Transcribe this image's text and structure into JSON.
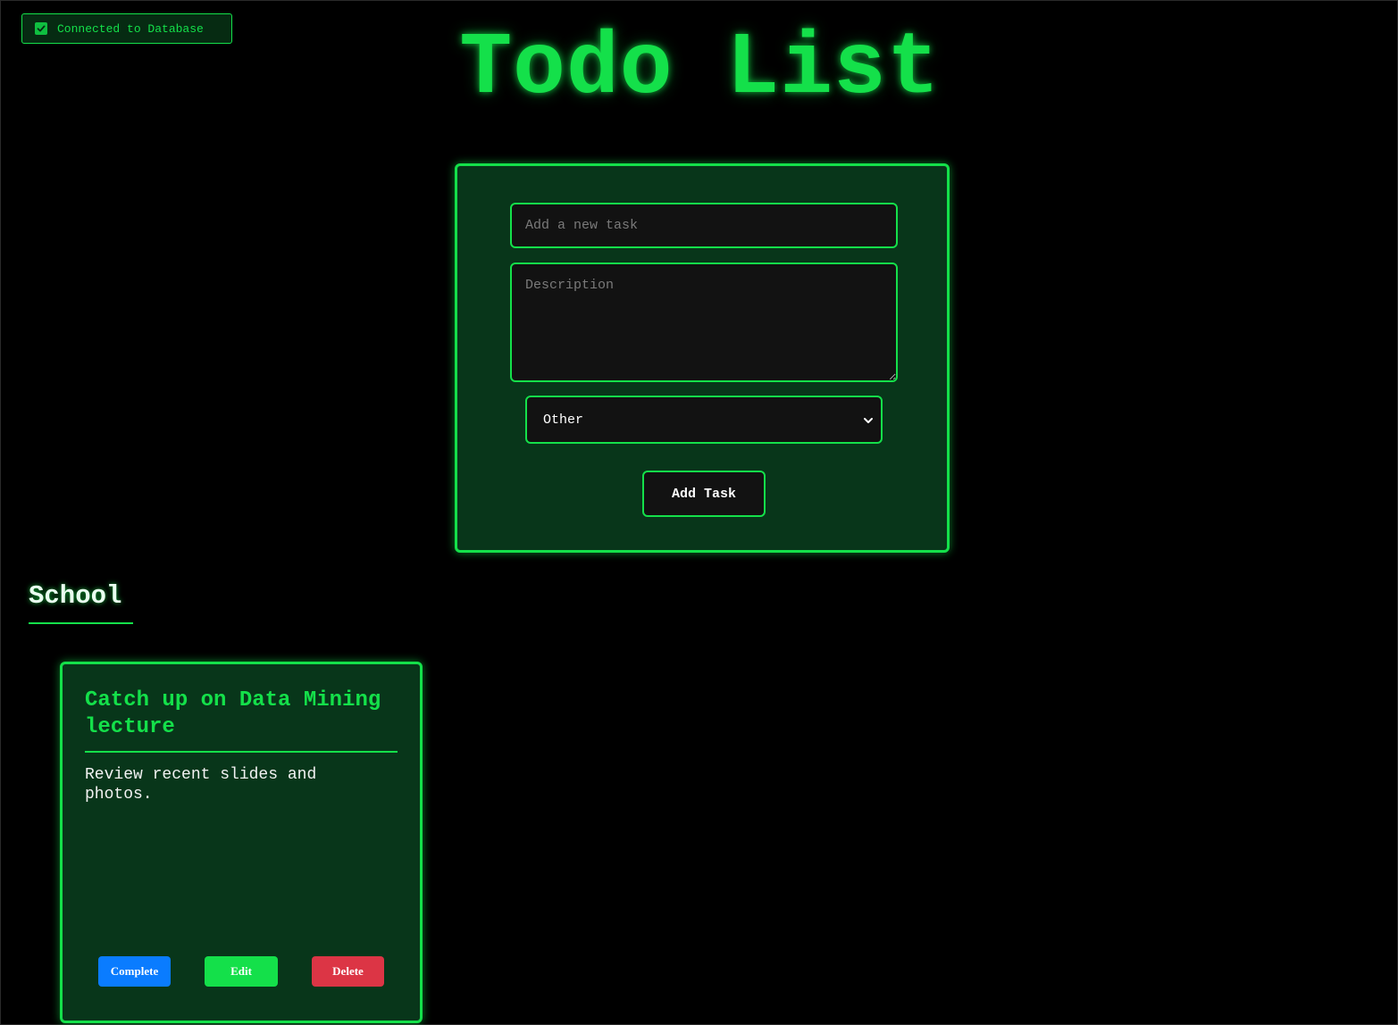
{
  "status": {
    "db_label": "Connected to Database",
    "color": "#14e04a"
  },
  "page": {
    "title": "Todo List"
  },
  "form": {
    "task_placeholder": "Add a new task",
    "task_value": "",
    "description_placeholder": "Description",
    "description_value": "",
    "category_selected": "Other",
    "add_button_label": "Add Task"
  },
  "sections": [
    {
      "heading": "School",
      "tasks": [
        {
          "title": "Catch up on Data Mining lecture",
          "description": "Review recent slides and photos.",
          "complete_label": "Complete",
          "edit_label": "Edit",
          "delete_label": "Delete"
        }
      ]
    }
  ],
  "colors": {
    "accent": "#14e04a",
    "card_bg": "#08361a",
    "complete": "#0a7cff",
    "edit": "#14e04a",
    "delete": "#dc3545"
  },
  "icons": {
    "status": "check-icon",
    "select": "chevron-down-icon"
  }
}
